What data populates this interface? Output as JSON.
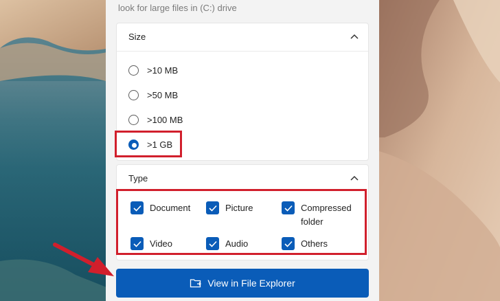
{
  "intro_text": "look for large files in (C:) drive",
  "size_section": {
    "title": "Size",
    "options": [
      {
        "label": ">10 MB",
        "selected": false
      },
      {
        "label": ">50 MB",
        "selected": false
      },
      {
        "label": ">100 MB",
        "selected": false
      },
      {
        "label": ">1 GB",
        "selected": true
      }
    ]
  },
  "type_section": {
    "title": "Type",
    "items": [
      {
        "label": "Document",
        "checked": true
      },
      {
        "label": "Picture",
        "checked": true
      },
      {
        "label": "Compressed folder",
        "checked": true
      },
      {
        "label": "Video",
        "checked": true
      },
      {
        "label": "Audio",
        "checked": true
      },
      {
        "label": "Others",
        "checked": true
      }
    ]
  },
  "view_button": {
    "label": "View in File Explorer",
    "icon": "folder-open-icon"
  },
  "colors": {
    "accent": "#0a5cb8",
    "highlight": "#d11f2c",
    "panel": "#f3f3f3"
  }
}
